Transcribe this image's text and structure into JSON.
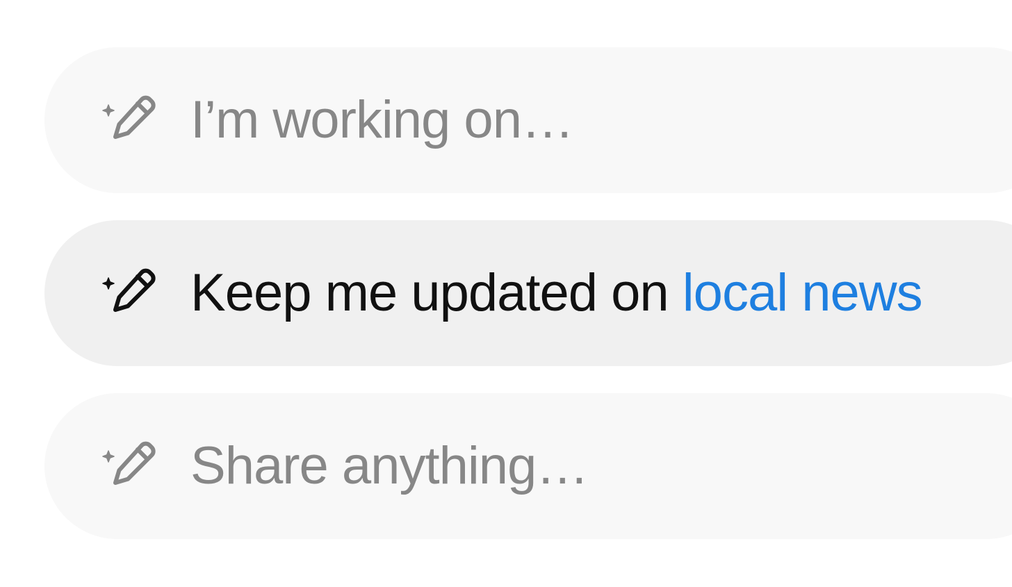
{
  "prompts": [
    {
      "text": "I’m working on…",
      "icon": "sparkle-pencil-icon",
      "state": "placeholder"
    },
    {
      "text": "Keep me updated on ",
      "highlight": "local news",
      "icon": "sparkle-pencil-icon",
      "state": "active"
    },
    {
      "text": "Share anything…",
      "icon": "sparkle-pencil-icon",
      "state": "placeholder"
    }
  ],
  "colors": {
    "placeholder_text": "#878787",
    "active_text": "#111111",
    "highlight": "#1e7fe0",
    "pill_inactive": "#f8f8f8",
    "pill_active": "#f0f0f0"
  }
}
